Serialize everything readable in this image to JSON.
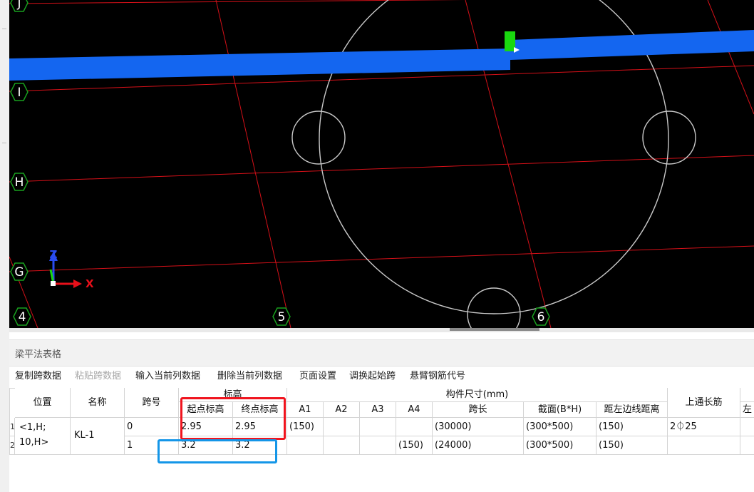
{
  "viewport": {
    "axis_labels": {
      "h_lines": [
        "J",
        "I",
        "H",
        "G"
      ],
      "v_lines": [
        "4",
        "5",
        "6"
      ]
    },
    "ucs": {
      "z_label": "Z",
      "x_label": "X"
    },
    "colors": {
      "background": "#000000",
      "grid": "#d51018",
      "beam": "#1466f0",
      "circle": "#c8c8c8",
      "marker": "#19d80f",
      "axis_bubble": "#19a01f"
    }
  },
  "panel": {
    "title": "梁平法表格",
    "toolbar": [
      {
        "label": "复制跨数据",
        "enabled": true
      },
      {
        "label": "粘贴跨数据",
        "enabled": false
      },
      {
        "label": "输入当前列数据",
        "enabled": true
      },
      {
        "label": "删除当前列数据",
        "enabled": true
      },
      {
        "label": "页面设置",
        "enabled": true
      },
      {
        "label": "调换起始跨",
        "enabled": true
      },
      {
        "label": "悬臂钢筋代号",
        "enabled": true
      }
    ],
    "headers": {
      "position": "位置",
      "name": "名称",
      "span_no": "跨号",
      "elevation_group": "标高",
      "start_elev": "起点标高",
      "end_elev": "终点标高",
      "size_group": "构件尺寸(mm)",
      "a1": "A1",
      "a2": "A2",
      "a3": "A3",
      "a4": "A4",
      "span_len": "跨长",
      "section": "截面(B*H)",
      "left_dist": "距左边线距离",
      "top_bar": "上通长筋",
      "extra": "左"
    },
    "rows": [
      {
        "num": "1",
        "position_l1": "<1,H;",
        "name": "KL-1",
        "span_no": "0",
        "start_elev": "2.95",
        "end_elev": "2.95",
        "a1": "(150)",
        "a2": "",
        "a3": "",
        "a4": "",
        "span_len": "(30000)",
        "section": "(300*500)",
        "left_dist": "(150)",
        "top_bar": "2⏀25"
      },
      {
        "num": "2",
        "position_l2": "10,H>",
        "span_no": "1",
        "start_elev": "3.2",
        "end_elev": "3.2",
        "a1": "",
        "a2": "",
        "a3": "",
        "a4": "(150)",
        "span_len": "(24000)",
        "section": "(300*500)",
        "left_dist": "(150)",
        "top_bar": ""
      }
    ],
    "highlight_colors": {
      "red": "#f0141e",
      "blue": "#1496e8"
    }
  }
}
